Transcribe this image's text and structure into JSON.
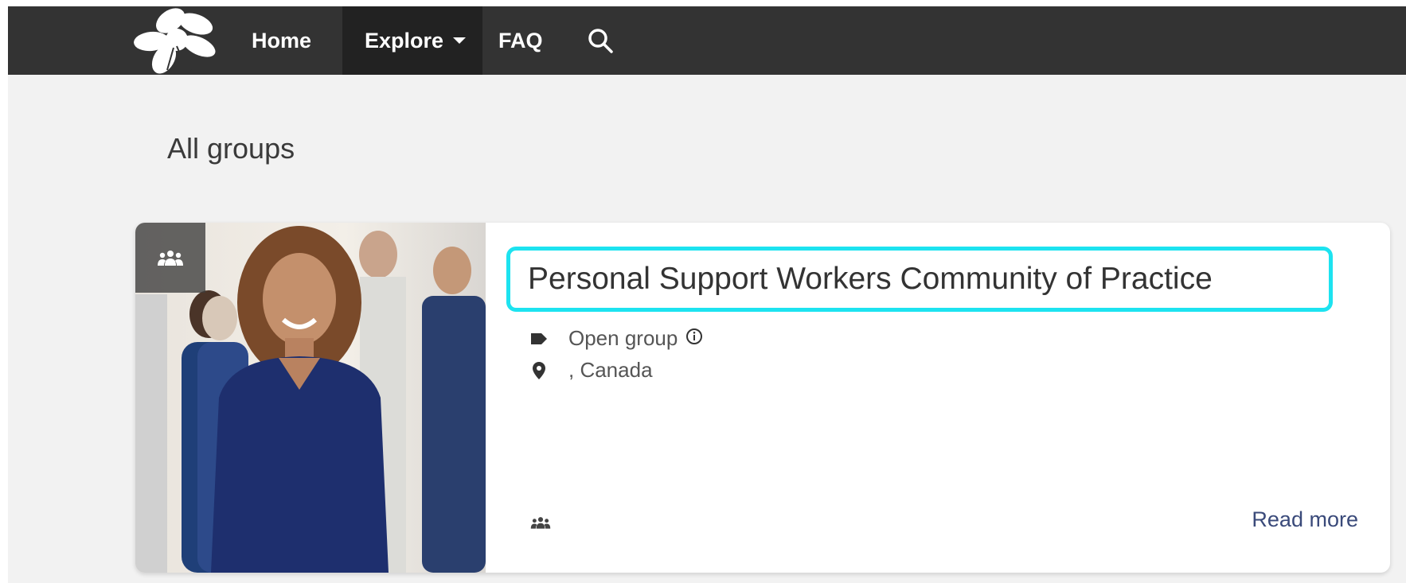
{
  "navbar": {
    "logo": "white-flower-logo",
    "items": [
      {
        "label": "Home"
      },
      {
        "label": "Explore"
      },
      {
        "label": "FAQ"
      }
    ],
    "search_icon": "search-icon"
  },
  "page_title": "All groups",
  "group_card": {
    "title": "Personal Support Workers Community of Practice",
    "type_label": "Open group",
    "location": ", Canada",
    "read_more": "Read more",
    "type_badge_icon": "group-icon",
    "highlight_color": "#1de3f0"
  },
  "colors": {
    "navbar_bg": "#333333",
    "nav_active_bg": "#222222",
    "page_bg": "#f2f2f2",
    "link": "#3a4a7a"
  }
}
